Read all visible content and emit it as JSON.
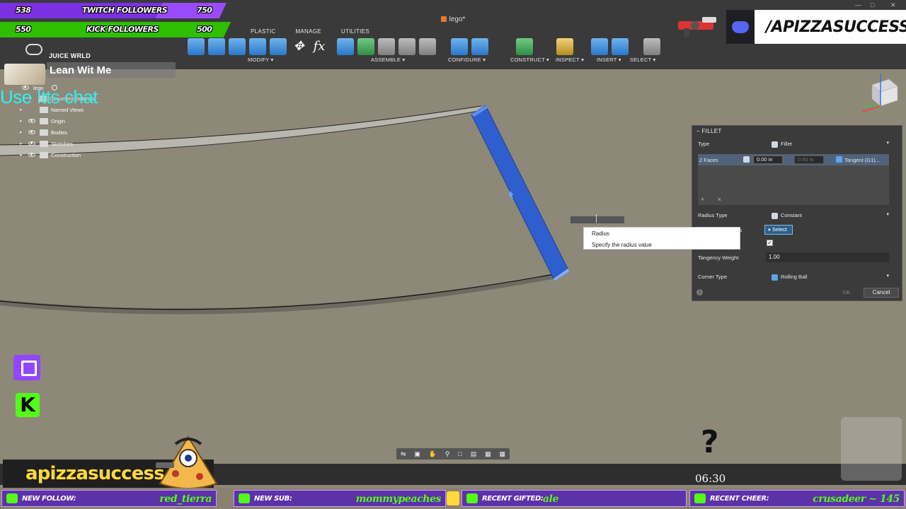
{
  "app": {
    "doc_title": "lego*",
    "tabs": [
      "PLASTIC",
      "MANAGE",
      "UTILITIES"
    ],
    "tool_groups": [
      "MODIFY",
      "ASSEMBLE",
      "CONFIGURE",
      "CONSTRUCT",
      "INSPECT",
      "INSERT",
      "SELECT"
    ]
  },
  "browser": {
    "items": [
      {
        "label": "lego"
      },
      {
        "label": "Document Settings"
      },
      {
        "label": "Named Views"
      },
      {
        "label": "Origin"
      },
      {
        "label": "Bodies"
      },
      {
        "label": "Sketches"
      },
      {
        "label": "Construction"
      }
    ]
  },
  "fillet_panel": {
    "title": "FILLET",
    "type_label": "Type",
    "type_value": "Fillet",
    "faces_label": "2 Faces",
    "radius_value": "0.00 in",
    "radius2_value": "0.00 in",
    "continuity_value": "Tangent (G1)...",
    "radius_type_label": "Radius Type",
    "radius_type_value": "Constant",
    "tangent_chain_label": "res",
    "select_label": "Select",
    "tangency_weight_label": "Tangency Weight",
    "tangency_weight_value": "1.00",
    "corner_type_label": "Corner Type",
    "corner_type_value": "Rolling Ball",
    "ok_label": "OK",
    "cancel_label": "Cancel",
    "tangent_chain_checked": true
  },
  "tooltip": {
    "title": "Radius",
    "description": "Specify the radius value"
  },
  "overlay": {
    "twitch_followers": {
      "count": "538",
      "label": "TWITCH FOLLOWERS",
      "goal": "750",
      "progress": 0.72
    },
    "kick_followers": {
      "count": "550",
      "label": "KICK FOLLOWERS",
      "goal": "500",
      "progress": 1.0
    },
    "now_playing": {
      "artist": "JUICE WRLD",
      "song": "Lean Wit Me"
    },
    "tts_text": "Use !tts chat",
    "channel_name": "apizzasuccess",
    "discord_handle": "/APIZZASUCCESS",
    "timer": "06:30",
    "question_mark": "?",
    "kick_letter": "K",
    "alerts": {
      "new_follow": {
        "label": "NEW FOLLOW:",
        "value": "red_tierra"
      },
      "new_sub": {
        "label": "NEW SUB:",
        "value": "mommypeaches"
      },
      "recent_gifted": {
        "label": "RECENT GIFTED:",
        "value": "ale"
      },
      "recent_cheer": {
        "label": "RECENT CHEER:",
        "value": "crusadeer ~ 145"
      }
    }
  },
  "colors": {
    "viewport_bg": "#8e8879",
    "selected_face": "#2f5fcf",
    "twitch_purple": "#9146ff",
    "kick_green": "#53fc18"
  }
}
